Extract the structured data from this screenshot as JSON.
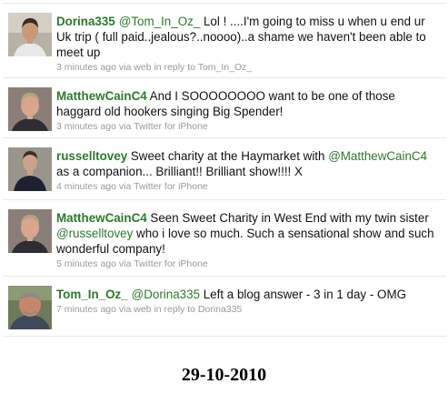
{
  "tweets": [
    {
      "user": "Dorina335",
      "parts": [
        {
          "type": "mention",
          "text": "@Tom_In_Oz_"
        },
        {
          "type": "text",
          "text": " Lol ! ....I'm going to miss u when u end ur Uk trip ( full paid..jealous?..noooo)..a shame we haven't been able to meet up"
        }
      ],
      "time": "3 minutes ago",
      "via_label": "via",
      "source": "web",
      "reply_prefix": "in reply to",
      "reply_to": "Tom_In_Oz_",
      "avatar_icon": "user-avatar-dorina335",
      "avatar_colors": {
        "bg": "#b8b2a6",
        "skin": "#c99a7a",
        "hair": "#3a2a22",
        "shirt": "#e8e8e8"
      }
    },
    {
      "user": "MatthewCainC4",
      "parts": [
        {
          "type": "text",
          "text": " And I SOOOOOOOO want to be one of those haggard old hookers singing Big Spender!"
        }
      ],
      "time": "3 minutes ago",
      "via_label": "via",
      "source": "Twitter for iPhone",
      "reply_prefix": "",
      "reply_to": "",
      "avatar_icon": "user-avatar-matthewcainc4",
      "avatar_colors": {
        "bg": "#8a7f78",
        "skin": "#d9a58c",
        "hair": "#b7a27e",
        "shirt": "#2d2d33"
      }
    },
    {
      "user": "russelltovey",
      "parts": [
        {
          "type": "text",
          "text": " Sweet charity at the Haymarket with "
        },
        {
          "type": "mention",
          "text": "@MatthewCainC4"
        },
        {
          "type": "text",
          "text": " as a companion... Brilliant!! Brilliant show!!!! X"
        }
      ],
      "time": "4 minutes ago",
      "via_label": "via",
      "source": "Twitter for iPhone",
      "reply_prefix": "",
      "reply_to": "",
      "avatar_icon": "user-avatar-russelltovey",
      "avatar_colors": {
        "bg": "#9a958c",
        "skin": "#caa28a",
        "hair": "#3b2f26",
        "shirt": "#1e2230"
      }
    },
    {
      "user": "MatthewCainC4",
      "parts": [
        {
          "type": "text",
          "text": " Seen Sweet Charity in West End with my twin sister "
        },
        {
          "type": "mention",
          "text": "@russelltovey"
        },
        {
          "type": "text",
          "text": " who i love so much. Such a sensational show and such wonderful company!"
        }
      ],
      "time": "5 minutes ago",
      "via_label": "via",
      "source": "Twitter for iPhone",
      "reply_prefix": "",
      "reply_to": "",
      "avatar_icon": "user-avatar-matthewcainc4",
      "avatar_colors": {
        "bg": "#8a7f78",
        "skin": "#d9a58c",
        "hair": "#b7a27e",
        "shirt": "#2d2d33"
      }
    },
    {
      "user": "Tom_In_Oz_",
      "parts": [
        {
          "type": "mention",
          "text": "@Dorina335"
        },
        {
          "type": "text",
          "text": " Left a blog answer - 3 in 1 day - OMG"
        }
      ],
      "time": "7 minutes ago",
      "via_label": "via",
      "source": "web",
      "reply_prefix": "in reply to",
      "reply_to": "Dorina335",
      "avatar_icon": "user-avatar-tom-in-oz",
      "avatar_colors": {
        "bg": "#6f7a5c",
        "skin": "#c7876c",
        "hair": "#8a8a86",
        "shirt": "#3e4a5a"
      }
    }
  ],
  "caption": "29-10-2010"
}
